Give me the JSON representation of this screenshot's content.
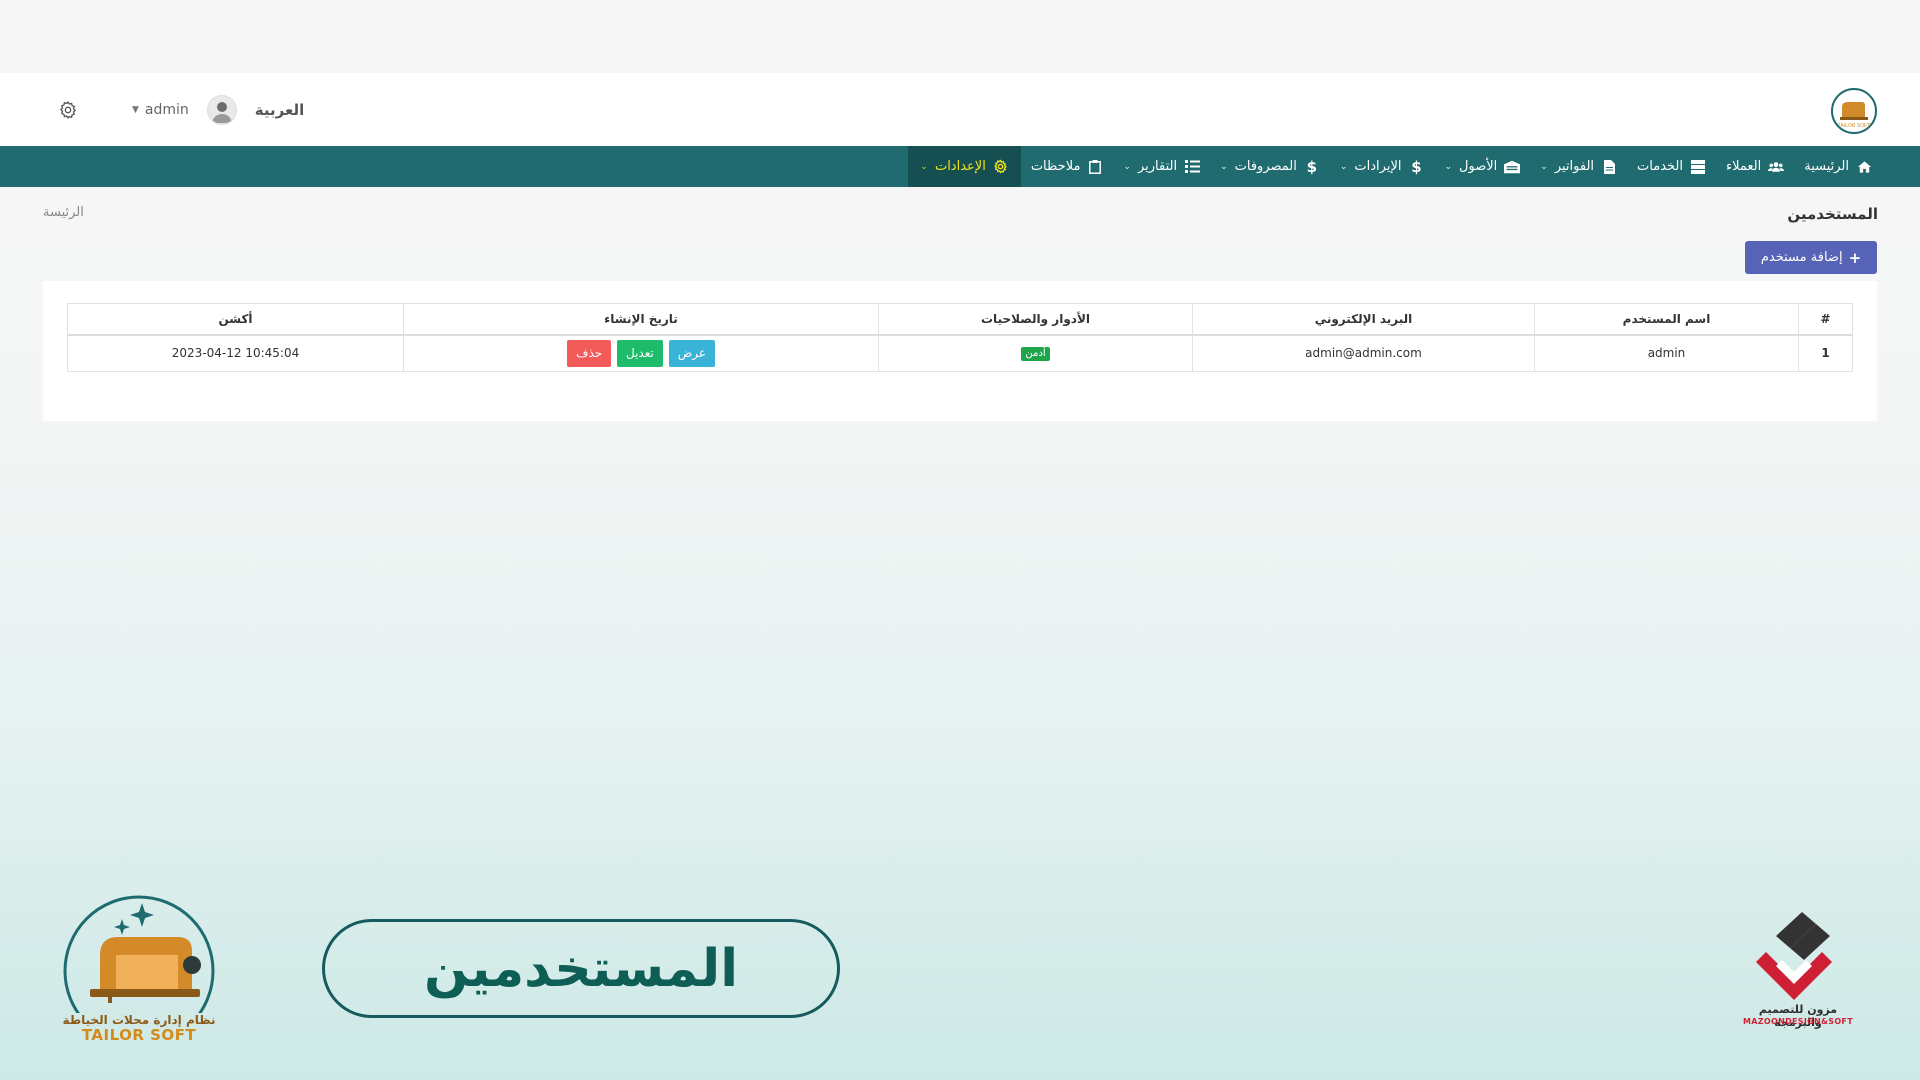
{
  "header": {
    "language": "العربية",
    "username": "admin",
    "icons": {
      "settings": "gear-icon",
      "avatar": "user-avatar",
      "logo": "sewing-machine-logo"
    }
  },
  "nav": {
    "items": [
      {
        "label": "الرئيسية",
        "icon": "home-icon",
        "dropdown": false
      },
      {
        "label": "العملاء",
        "icon": "users-icon",
        "dropdown": false
      },
      {
        "label": "الخدمات",
        "icon": "server-icon",
        "dropdown": false
      },
      {
        "label": "الفواتير",
        "icon": "file-icon",
        "dropdown": true
      },
      {
        "label": "الأصول",
        "icon": "warehouse-icon",
        "dropdown": true
      },
      {
        "label": "الإيرادات",
        "icon": "dollar-icon",
        "dropdown": true
      },
      {
        "label": "المصروفات",
        "icon": "dollar-icon",
        "dropdown": true
      },
      {
        "label": "التقارير",
        "icon": "list-icon",
        "dropdown": true
      },
      {
        "label": "ملاحظات",
        "icon": "clipboard-icon",
        "dropdown": false
      },
      {
        "label": "الإعدادات",
        "icon": "cog-icon",
        "dropdown": true,
        "active": true
      }
    ],
    "active_color": "#f2e21a",
    "bar_color": "#1f6b6f"
  },
  "page": {
    "title": "المستخدمين",
    "breadcrumb": "الرئيسة",
    "add_button_label": "إضافة مستخدم",
    "add_button_icon": "plus-icon"
  },
  "table": {
    "headers": [
      "#",
      "اسم المستخدم",
      "البريد الإلكتروني",
      "الأدوار والصلاحيات",
      "تاريخ الإنشاء",
      "أكشن"
    ],
    "rows": [
      {
        "index": "1",
        "username": "admin",
        "email": "admin@admin.com",
        "role": "أدمن",
        "actions": {
          "view": "عرض",
          "edit": "تعديل",
          "delete": "حذف"
        },
        "created_at": "2023-04-12 10:45:04"
      }
    ]
  },
  "footer": {
    "tailor_caption_ar": "نظام إدارة محلات الخياطة",
    "tailor_caption_en": "TAILOR SOFT",
    "banner_text": "المستخدمين",
    "mazoon_ar": "مزون للتصميم والبرمجة",
    "mazoon_en": "MAZOONDESIGN&SOFT"
  }
}
